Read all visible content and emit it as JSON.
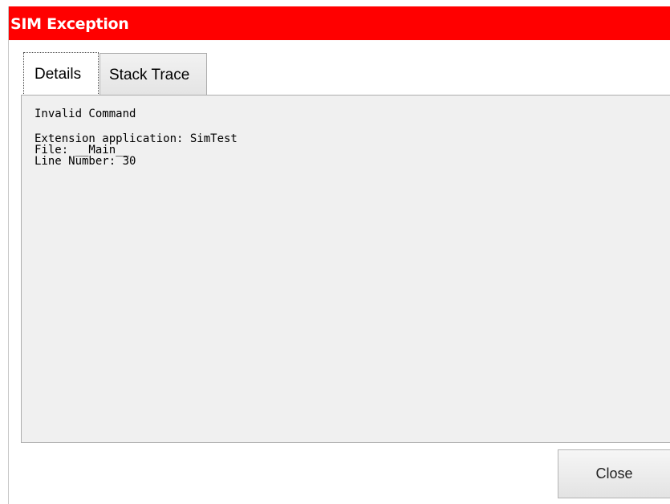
{
  "window": {
    "title": "SIM Exception",
    "title_bar_color": "#ff0000"
  },
  "tabs": [
    {
      "label": "Details",
      "selected": true
    },
    {
      "label": "Stack Trace",
      "selected": false
    }
  ],
  "details": {
    "message": "Invalid Command",
    "extension_application": "Extension application: SimTest",
    "file": "File: __Main__",
    "line_number": "Line Number: 30"
  },
  "buttons": {
    "close_label": "Close"
  }
}
